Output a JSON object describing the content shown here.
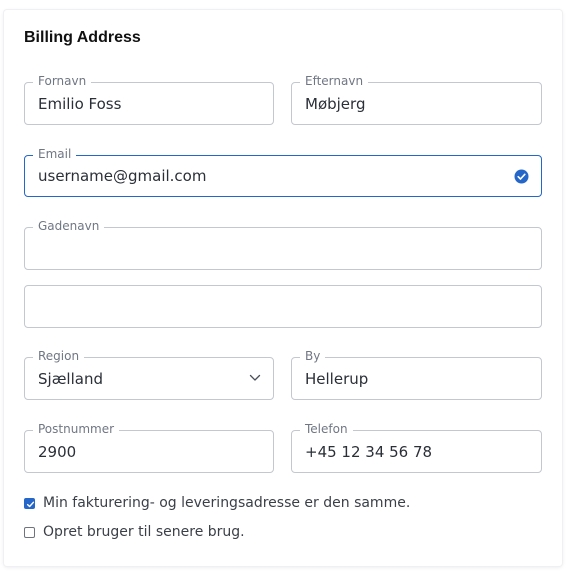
{
  "form": {
    "title": "Billing Address",
    "first_name": {
      "label": "Fornavn",
      "value": "Emilio Foss"
    },
    "last_name": {
      "label": "Efternavn",
      "value": "Møbjerg"
    },
    "email": {
      "label": "Email",
      "value": "username@gmail.com",
      "valid": true
    },
    "street": {
      "label": "Gadenavn",
      "value": ""
    },
    "street2": {
      "label": "",
      "value": ""
    },
    "region": {
      "label": "Region",
      "value": "Sjælland"
    },
    "city": {
      "label": "By",
      "value": "Hellerup"
    },
    "postal_code": {
      "label": "Postnummer",
      "value": "2900"
    },
    "phone": {
      "label": "Telefon",
      "value": "+45 12 34 56 78"
    },
    "same_address": {
      "label": "Min fakturering- og leveringsadresse er den samme.",
      "checked": true
    },
    "create_account": {
      "label": "Opret bruger til senere brug.",
      "checked": false
    }
  },
  "colors": {
    "accent": "#2566c9",
    "border": "#c3c7cf",
    "label": "#707784",
    "text": "#2a2f38"
  },
  "icons": {
    "email_status": "check-circle-icon",
    "region_dropdown": "chevron-down-icon"
  }
}
